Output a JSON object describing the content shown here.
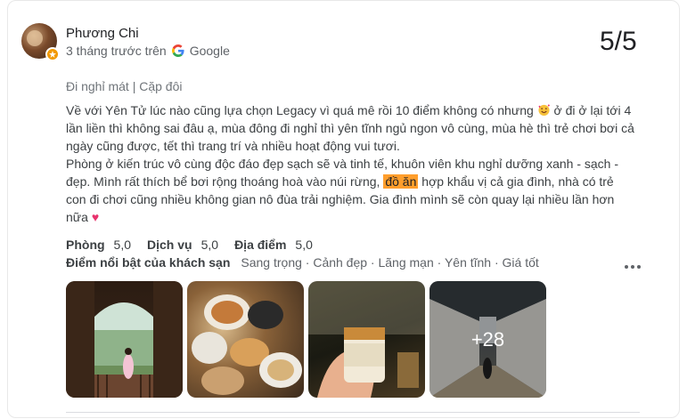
{
  "review": {
    "author": "Phương Chi",
    "time_text": "3 tháng trước trên",
    "source": "Google",
    "score": "5/5",
    "trip_type": "Đi nghỉ mát | Cặp đôi",
    "text_line1_a": "Về với Yên Tử lúc nào cũng lựa chọn Legacy vì quá mê rồi 10 điểm không có nhưng",
    "text_line1_b": "ở đi ở lại tới 4 lần liền thì không sai đâu ạ, mùa đông đi nghỉ thì yên tĩnh ngủ ngon vô cùng, mùa hè thì trẻ chơi bơi cả ngày cũng được, tết thì trang trí và nhiều hoạt động vui tươi.",
    "text_para2_a": "Phòng ở kiến trúc vô cùng độc đáo đẹp sạch sẽ và tinh tế, khuôn viên khu nghỉ dưỡng xanh - sạch - đẹp. Mình rất thích bể bơi rộng thoáng hoà vào núi rừng,",
    "text_highlight": "đồ ăn",
    "text_para2_b": "hợp khẩu vị cả gia đình, nhà có trẻ con đi chơi cũng nhiều không gian nô đùa trải nghiệm. Gia đình mình sẽ còn quay lại nhiều lần hơn nữa",
    "ratings": [
      {
        "label": "Phòng",
        "value": "5,0"
      },
      {
        "label": "Dịch vụ",
        "value": "5,0"
      },
      {
        "label": "Địa điểm",
        "value": "5,0"
      }
    ],
    "highlights_label": "Điểm nổi bật của khách sạn",
    "highlights_value": "Sang trọng · Cảnh đẹp · Lãng mạn · Yên tĩnh · Giá tốt",
    "more_photos": "+28"
  },
  "colors": {
    "highlight": "#ff9e2c",
    "badge": "#f29900",
    "heart": "#e8336d"
  },
  "icons": [
    "google-g-icon",
    "local-guide-badge-icon",
    "smiling-face-with-hearts-emoji",
    "heart-emoji",
    "more-options-icon"
  ]
}
